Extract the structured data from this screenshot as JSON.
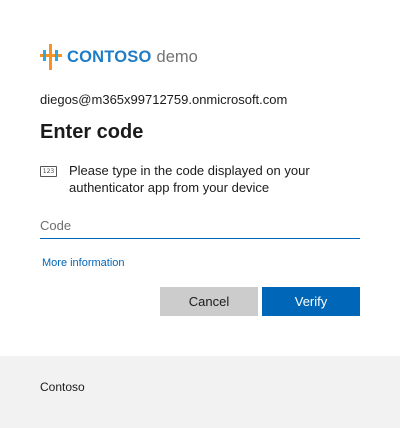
{
  "logo": {
    "brand": "CONTOSO",
    "suffix": "demo"
  },
  "identity": {
    "email": "diegos@m365x99712759.onmicrosoft.com"
  },
  "page": {
    "title": "Enter code"
  },
  "prompt": {
    "icon": "numeric-code-icon",
    "icon_text": "123",
    "text": "Please type in the code displayed on your authenticator app from your device"
  },
  "code_input": {
    "placeholder": "Code",
    "value": ""
  },
  "links": {
    "more_information": "More information"
  },
  "buttons": {
    "cancel": "Cancel",
    "verify": "Verify"
  },
  "footer": {
    "text": "Contoso"
  },
  "colors": {
    "accent": "#0067b8",
    "brand": "#1f7cc6",
    "cancel_bg": "#cccccc",
    "footer_bg": "#f2f2f2"
  }
}
